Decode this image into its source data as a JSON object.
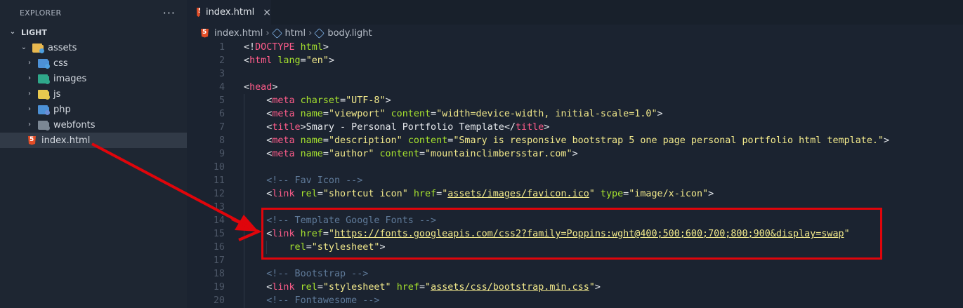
{
  "explorer": {
    "title": "EXPLORER",
    "more": "···",
    "root": "LIGHT",
    "items": [
      {
        "label": "assets",
        "chev": "⌄",
        "color": "#e8b84f",
        "badge": "#4fa1e0"
      },
      {
        "label": "css",
        "chev": "›",
        "color": "#4c91d6",
        "badge": "#4fa1e0"
      },
      {
        "label": "images",
        "chev": "›",
        "color": "#2fa88a",
        "badge": "#2fa88a"
      },
      {
        "label": "js",
        "chev": "›",
        "color": "#e8c94f",
        "badge": "#e8c94f"
      },
      {
        "label": "php",
        "chev": "›",
        "color": "#4c91d6",
        "badge": "#6c8ed6"
      },
      {
        "label": "webfonts",
        "chev": "›",
        "color": "#7b8794",
        "badge": "#7b8794"
      },
      {
        "label": "index.html"
      }
    ]
  },
  "tab": {
    "label": "index.html",
    "close": "×"
  },
  "breadcrumb": {
    "file": "index.html",
    "node1": "html",
    "node2": "body.light"
  },
  "code_lines": [
    {
      "n": "1",
      "html": "<span class='p'>&lt;!</span><span class='t'>DOCTYPE</span> <span class='a'>html</span><span class='p'>&gt;</span>"
    },
    {
      "n": "2",
      "html": "<span class='p'>&lt;</span><span class='t'>html</span> <span class='a'>lang</span><span class='p'>=</span><span class='s'>\"en\"</span><span class='p'>&gt;</span>"
    },
    {
      "n": "3",
      "html": ""
    },
    {
      "n": "4",
      "html": "<span class='p'>&lt;</span><span class='t'>head</span><span class='p'>&gt;</span>"
    },
    {
      "n": "5",
      "html": "    <span class='p'>&lt;</span><span class='t'>meta</span> <span class='a'>charset</span><span class='p'>=</span><span class='s'>\"UTF-8\"</span><span class='p'>&gt;</span>"
    },
    {
      "n": "6",
      "html": "    <span class='p'>&lt;</span><span class='t'>meta</span> <span class='a'>name</span><span class='p'>=</span><span class='s'>\"viewport\"</span> <span class='a'>content</span><span class='p'>=</span><span class='s'>\"width=device-width, initial-scale=1.0\"</span><span class='p'>&gt;</span>"
    },
    {
      "n": "7",
      "html": "    <span class='p'>&lt;</span><span class='t'>title</span><span class='p'>&gt;Smary - Personal Portfolio Template&lt;/</span><span class='t'>title</span><span class='p'>&gt;</span>"
    },
    {
      "n": "8",
      "html": "    <span class='p'>&lt;</span><span class='t'>meta</span> <span class='a'>name</span><span class='p'>=</span><span class='s'>\"description\"</span> <span class='a'>content</span><span class='p'>=</span><span class='s'>\"Smary is responsive bootstrap 5 one page personal portfolio html template.\"</span><span class='p'>&gt;</span>"
    },
    {
      "n": "9",
      "html": "    <span class='p'>&lt;</span><span class='t'>meta</span> <span class='a'>name</span><span class='p'>=</span><span class='s'>\"author\"</span> <span class='a'>content</span><span class='p'>=</span><span class='s'>\"mountainclimbersstar.com\"</span><span class='p'>&gt;</span>"
    },
    {
      "n": "10",
      "html": ""
    },
    {
      "n": "11",
      "html": "    <span class='c'>&lt;!-- Fav Icon --&gt;</span>"
    },
    {
      "n": "12",
      "html": "    <span class='p'>&lt;</span><span class='t'>link</span> <span class='a'>rel</span><span class='p'>=</span><span class='s'>\"shortcut icon\"</span> <span class='a'>href</span><span class='p'>=</span><span class='s'>\"<span class='u'>assets/images/favicon.ico</span>\"</span> <span class='a'>type</span><span class='p'>=</span><span class='s'>\"image/x-icon\"</span><span class='p'>&gt;</span>"
    },
    {
      "n": "13",
      "html": ""
    },
    {
      "n": "14",
      "html": "    <span class='c'>&lt;!-- Template Google Fonts --&gt;</span>"
    },
    {
      "n": "15",
      "html": "    <span class='p'>&lt;</span><span class='t'>link</span> <span class='a'>href</span><span class='p'>=</span><span class='s'>\"<span class='u'>https://fonts.googleapis.com/css2?family=Poppins:wght@400;500;600;700;800;900&amp;display=swap</span>\"</span>"
    },
    {
      "n": "16",
      "html": "        <span class='a'>rel</span><span class='p'>=</span><span class='s'>\"stylesheet\"</span><span class='p'>&gt;</span>"
    },
    {
      "n": "17",
      "html": ""
    },
    {
      "n": "18",
      "html": "    <span class='c'>&lt;!-- Bootstrap --&gt;</span>"
    },
    {
      "n": "19",
      "html": "    <span class='p'>&lt;</span><span class='t'>link</span> <span class='a'>rel</span><span class='p'>=</span><span class='s'>\"stylesheet\"</span> <span class='a'>href</span><span class='p'>=</span><span class='s'>\"<span class='u'>assets/css/bootstrap.min.css</span>\"</span><span class='p'>&gt;</span>"
    },
    {
      "n": "20",
      "html": "    <span class='c'>&lt;!-- Fontawesome --&gt;</span>"
    }
  ],
  "colors": {
    "annotation": "#e0050b",
    "tag": "#ff5c8a",
    "attr": "#a6e22e",
    "string": "#f2e98b",
    "comment": "#5f7a99"
  }
}
